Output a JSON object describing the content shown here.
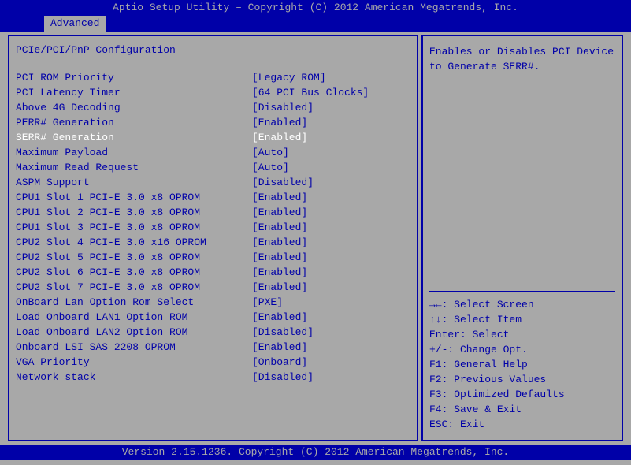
{
  "header": "Aptio Setup Utility – Copyright (C) 2012 American Megatrends, Inc.",
  "tab": "Advanced",
  "section_title": "PCIe/PCI/PnP Configuration",
  "help_text_1": "Enables or Disables PCI Device",
  "help_text_2": "to Generate SERR#.",
  "rows": [
    {
      "label": "PCI ROM Priority",
      "value": "[Legacy ROM]"
    },
    {
      "label": "PCI Latency Timer",
      "value": "[64 PCI Bus Clocks]"
    },
    {
      "label": "Above 4G Decoding",
      "value": "[Disabled]"
    },
    {
      "label": "PERR# Generation",
      "value": "[Enabled]"
    },
    {
      "label": "SERR# Generation",
      "value": "[Enabled]"
    },
    {
      "label": "Maximum Payload",
      "value": "[Auto]"
    },
    {
      "label": "Maximum Read Request",
      "value": "[Auto]"
    },
    {
      "label": "ASPM Support",
      "value": "[Disabled]"
    },
    {
      "label": "CPU1 Slot 1 PCI-E 3.0 x8 OPROM",
      "value": "[Enabled]"
    },
    {
      "label": "CPU1 Slot 2 PCI-E 3.0 x8 OPROM",
      "value": "[Enabled]"
    },
    {
      "label": "CPU1 Slot 3 PCI-E 3.0 x8 OPROM",
      "value": "[Enabled]"
    },
    {
      "label": "CPU2 Slot 4 PCI-E 3.0 x16 OPROM",
      "value": "[Enabled]"
    },
    {
      "label": "CPU2 Slot 5 PCI-E 3.0 x8 OPROM",
      "value": "[Enabled]"
    },
    {
      "label": "CPU2 Slot 6 PCI-E 3.0 x8 OPROM",
      "value": "[Enabled]"
    },
    {
      "label": "CPU2 Slot 7 PCI-E 3.0 x8 OPROM",
      "value": "[Enabled]"
    },
    {
      "label": "OnBoard Lan Option Rom Select",
      "value": "[PXE]"
    },
    {
      "label": "Load Onboard LAN1 Option ROM",
      "value": "[Enabled]"
    },
    {
      "label": "Load Onboard LAN2 Option ROM",
      "value": "[Disabled]"
    },
    {
      "label": "Onboard LSI SAS 2208 OPROM",
      "value": "[Enabled]"
    },
    {
      "label": "VGA Priority",
      "value": "[Onboard]"
    },
    {
      "label": "Network stack",
      "value": "[Disabled]"
    }
  ],
  "selected_index": 4,
  "keys": [
    "→←: Select Screen",
    "↑↓: Select Item",
    "Enter: Select",
    "+/-: Change Opt.",
    "F1: General Help",
    "F2: Previous Values",
    "F3: Optimized Defaults",
    "F4: Save & Exit",
    "ESC: Exit"
  ],
  "footer": "Version 2.15.1236. Copyright (C) 2012 American Megatrends, Inc."
}
